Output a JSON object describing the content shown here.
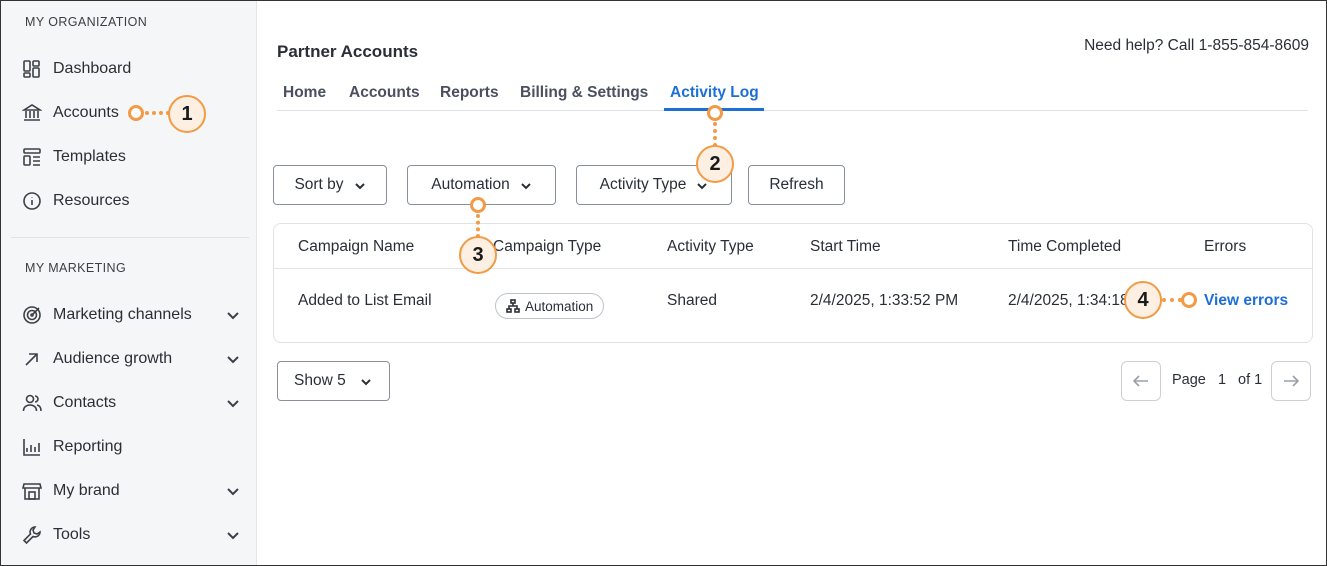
{
  "sidebar": {
    "org_label": "MY ORGANIZATION",
    "org_items": [
      {
        "label": "Dashboard",
        "icon": "dashboard-icon"
      },
      {
        "label": "Accounts",
        "icon": "bank-icon"
      },
      {
        "label": "Templates",
        "icon": "templates-icon"
      },
      {
        "label": "Resources",
        "icon": "info-icon"
      }
    ],
    "marketing_label": "MY MARKETING",
    "marketing_items": [
      {
        "label": "Marketing channels",
        "icon": "target-icon",
        "expandable": true
      },
      {
        "label": "Audience growth",
        "icon": "arrow-up-right-icon",
        "expandable": true
      },
      {
        "label": "Contacts",
        "icon": "people-icon",
        "expandable": true
      },
      {
        "label": "Reporting",
        "icon": "chart-icon",
        "expandable": false
      },
      {
        "label": "My brand",
        "icon": "store-icon",
        "expandable": true
      },
      {
        "label": "Tools",
        "icon": "wrench-icon",
        "expandable": true
      }
    ]
  },
  "header": {
    "title": "Partner Accounts",
    "help": "Need help? Call 1-855-854-8609"
  },
  "tabs": [
    {
      "label": "Home"
    },
    {
      "label": "Accounts"
    },
    {
      "label": "Reports"
    },
    {
      "label": "Billing & Settings"
    },
    {
      "label": "Activity Log",
      "active": true
    }
  ],
  "filters": {
    "sort_by": "Sort by",
    "automation": "Automation",
    "activity_type": "Activity Type",
    "refresh": "Refresh"
  },
  "table": {
    "columns": [
      "Campaign Name",
      "Campaign Type",
      "Activity Type",
      "Start Time",
      "Time Completed",
      "Errors"
    ],
    "rows": [
      {
        "campaign_name": "Added to List Email",
        "campaign_type": "Automation",
        "activity_type": "Shared",
        "start_time": "2/4/2025, 1:33:52 PM",
        "time_completed": "2/4/2025, 1:34:18",
        "errors_link": "View errors"
      }
    ]
  },
  "pagination": {
    "show": "Show 5",
    "page_label": "Page",
    "page": "1",
    "of": "of 1"
  },
  "callouts": [
    "1",
    "2",
    "3",
    "4"
  ],
  "colors": {
    "accent": "#1d6fd6",
    "callout": "#f29a45",
    "sidebar_bg": "#f5f6f8"
  }
}
